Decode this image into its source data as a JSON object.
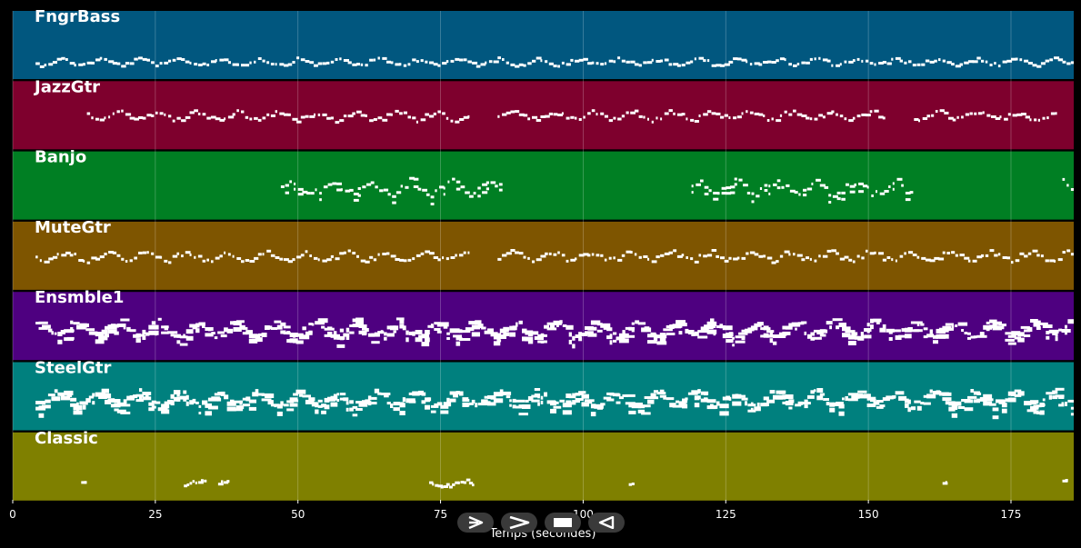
{
  "chart_data": {
    "type": "piano-roll",
    "xlabel": "Temps (secondes)",
    "xlim": [
      0,
      186
    ],
    "x_ticks": [
      0,
      25,
      50,
      75,
      100,
      125,
      150,
      175
    ],
    "grid": true,
    "tracks": [
      {
        "name": "FngrBass",
        "color": "#01577f",
        "segments": [
          [
            4,
            186
          ]
        ],
        "density": "dense",
        "pitch_band": "low"
      },
      {
        "name": "JazzGtr",
        "color": "#7e002d",
        "segments": [
          [
            13,
            80
          ],
          [
            85,
            153
          ],
          [
            158,
            183
          ]
        ],
        "density": "dense",
        "pitch_band": "mid"
      },
      {
        "name": "Banjo",
        "color": "#007f23",
        "segments": [
          [
            47,
            86
          ],
          [
            119,
            158
          ],
          [
            184,
            186
          ]
        ],
        "density": "dense",
        "pitch_band": "wide"
      },
      {
        "name": "MuteGtr",
        "color": "#7e5500",
        "segments": [
          [
            4,
            80
          ],
          [
            85,
            186
          ]
        ],
        "density": "dense",
        "pitch_band": "mid"
      },
      {
        "name": "Ensmble1",
        "color": "#4e0080",
        "segments": [
          [
            4,
            186
          ]
        ],
        "density": "very-dense",
        "pitch_band": "wide"
      },
      {
        "name": "SteelGtr",
        "color": "#00807e",
        "segments": [
          [
            4,
            186
          ]
        ],
        "density": "very-dense",
        "pitch_band": "wide"
      },
      {
        "name": "Classic",
        "color": "#7f8000",
        "segments": [
          [
            12,
            13
          ],
          [
            30,
            34
          ],
          [
            36,
            38
          ],
          [
            73,
            81
          ],
          [
            108,
            109
          ],
          [
            163,
            164
          ],
          [
            184,
            185
          ]
        ],
        "density": "sparse",
        "pitch_band": "low"
      }
    ]
  },
  "controls": [
    {
      "name": "play-icon"
    },
    {
      "name": "forward-icon"
    },
    {
      "name": "stop-icon"
    },
    {
      "name": "rewind-icon"
    }
  ]
}
